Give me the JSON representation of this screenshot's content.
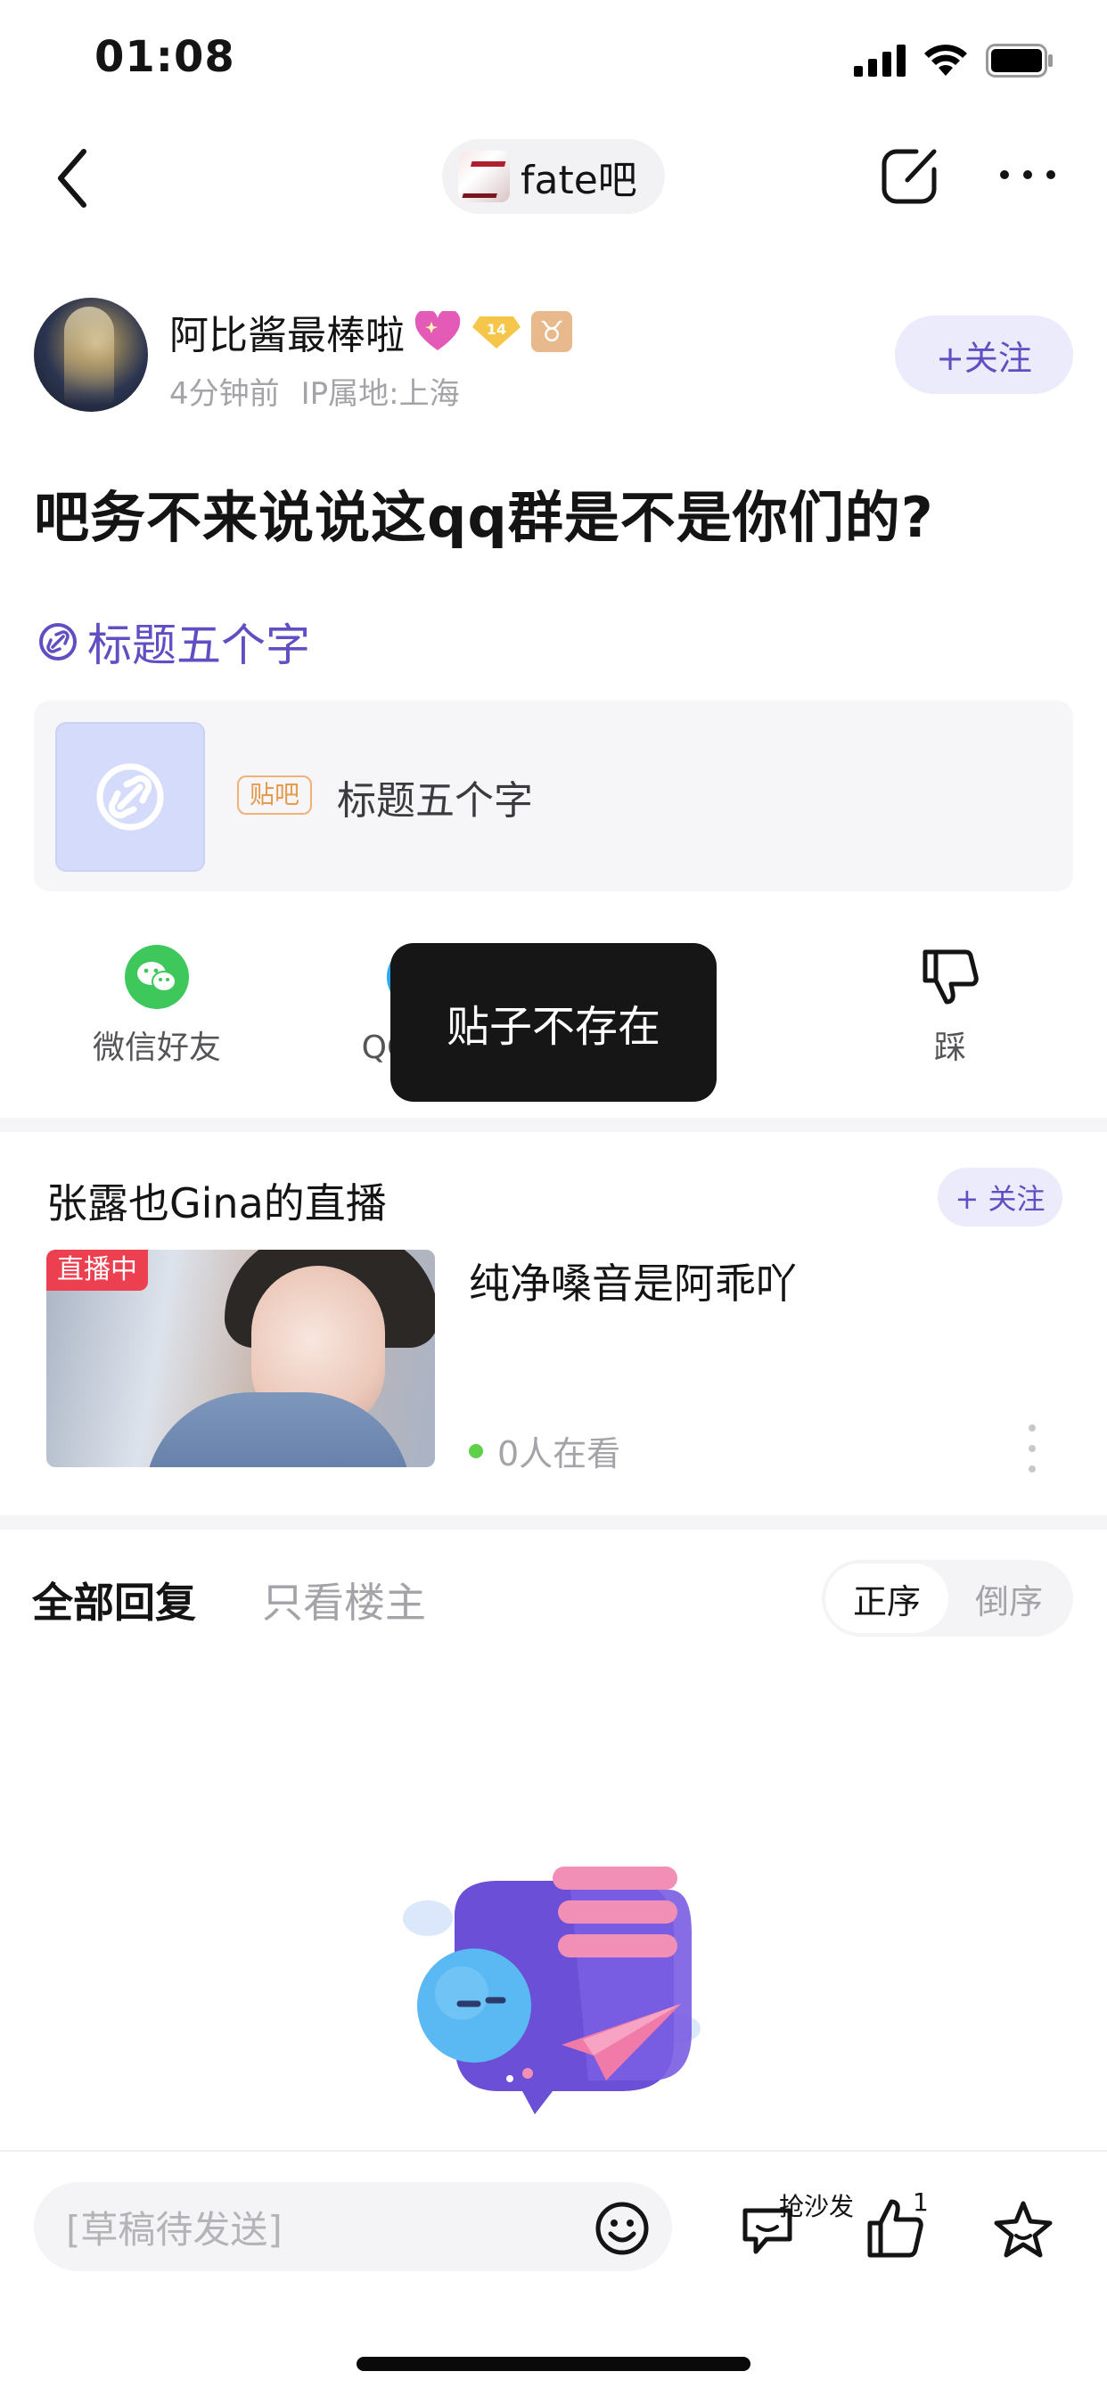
{
  "status_bar": {
    "time": "01:08"
  },
  "nav": {
    "forum_name": "fate吧"
  },
  "author": {
    "name": "阿比酱最棒啦",
    "level": "14",
    "zodiac_symbol": "♉",
    "time_ago": "4分钟前",
    "ip_location": "IP属地:上海",
    "follow_label": "+关注"
  },
  "post": {
    "title": "吧务不来说说这qq群是不是你们的?",
    "link_text": "标题五个字",
    "card": {
      "tag": "贴吧",
      "title": "标题五个字"
    }
  },
  "share": {
    "wechat_label": "微信好友",
    "qq_label": "QQ好友",
    "like_count": "1",
    "dislike_label": "踩"
  },
  "toast": {
    "message": "贴子不存在"
  },
  "live": {
    "host_title": "张露也Gina的直播",
    "follow_label": "+ 关注",
    "badge": "直播中",
    "stream_title": "纯净嗓音是阿乖吖",
    "viewers": "0人在看"
  },
  "replies": {
    "tab_all": "全部回复",
    "tab_op_only": "只看楼主",
    "sort_asc": "正序",
    "sort_desc": "倒序"
  },
  "bottom_bar": {
    "draft_placeholder": "[草稿待发送]",
    "sofa_label": "抢沙发",
    "like_count": "1"
  },
  "colors": {
    "accent": "#614ec2",
    "accent_bg": "#ecebfb",
    "live_badge": "#ec3f50",
    "wechat": "#3ec75a",
    "toast_bg": "#161616"
  },
  "icons": [
    "back-icon",
    "edit-icon",
    "more-icon",
    "link-icon",
    "wechat-icon",
    "qq-icon",
    "thumb-up-icon",
    "thumb-down-icon",
    "emoji-icon",
    "comment-icon",
    "star-icon"
  ]
}
